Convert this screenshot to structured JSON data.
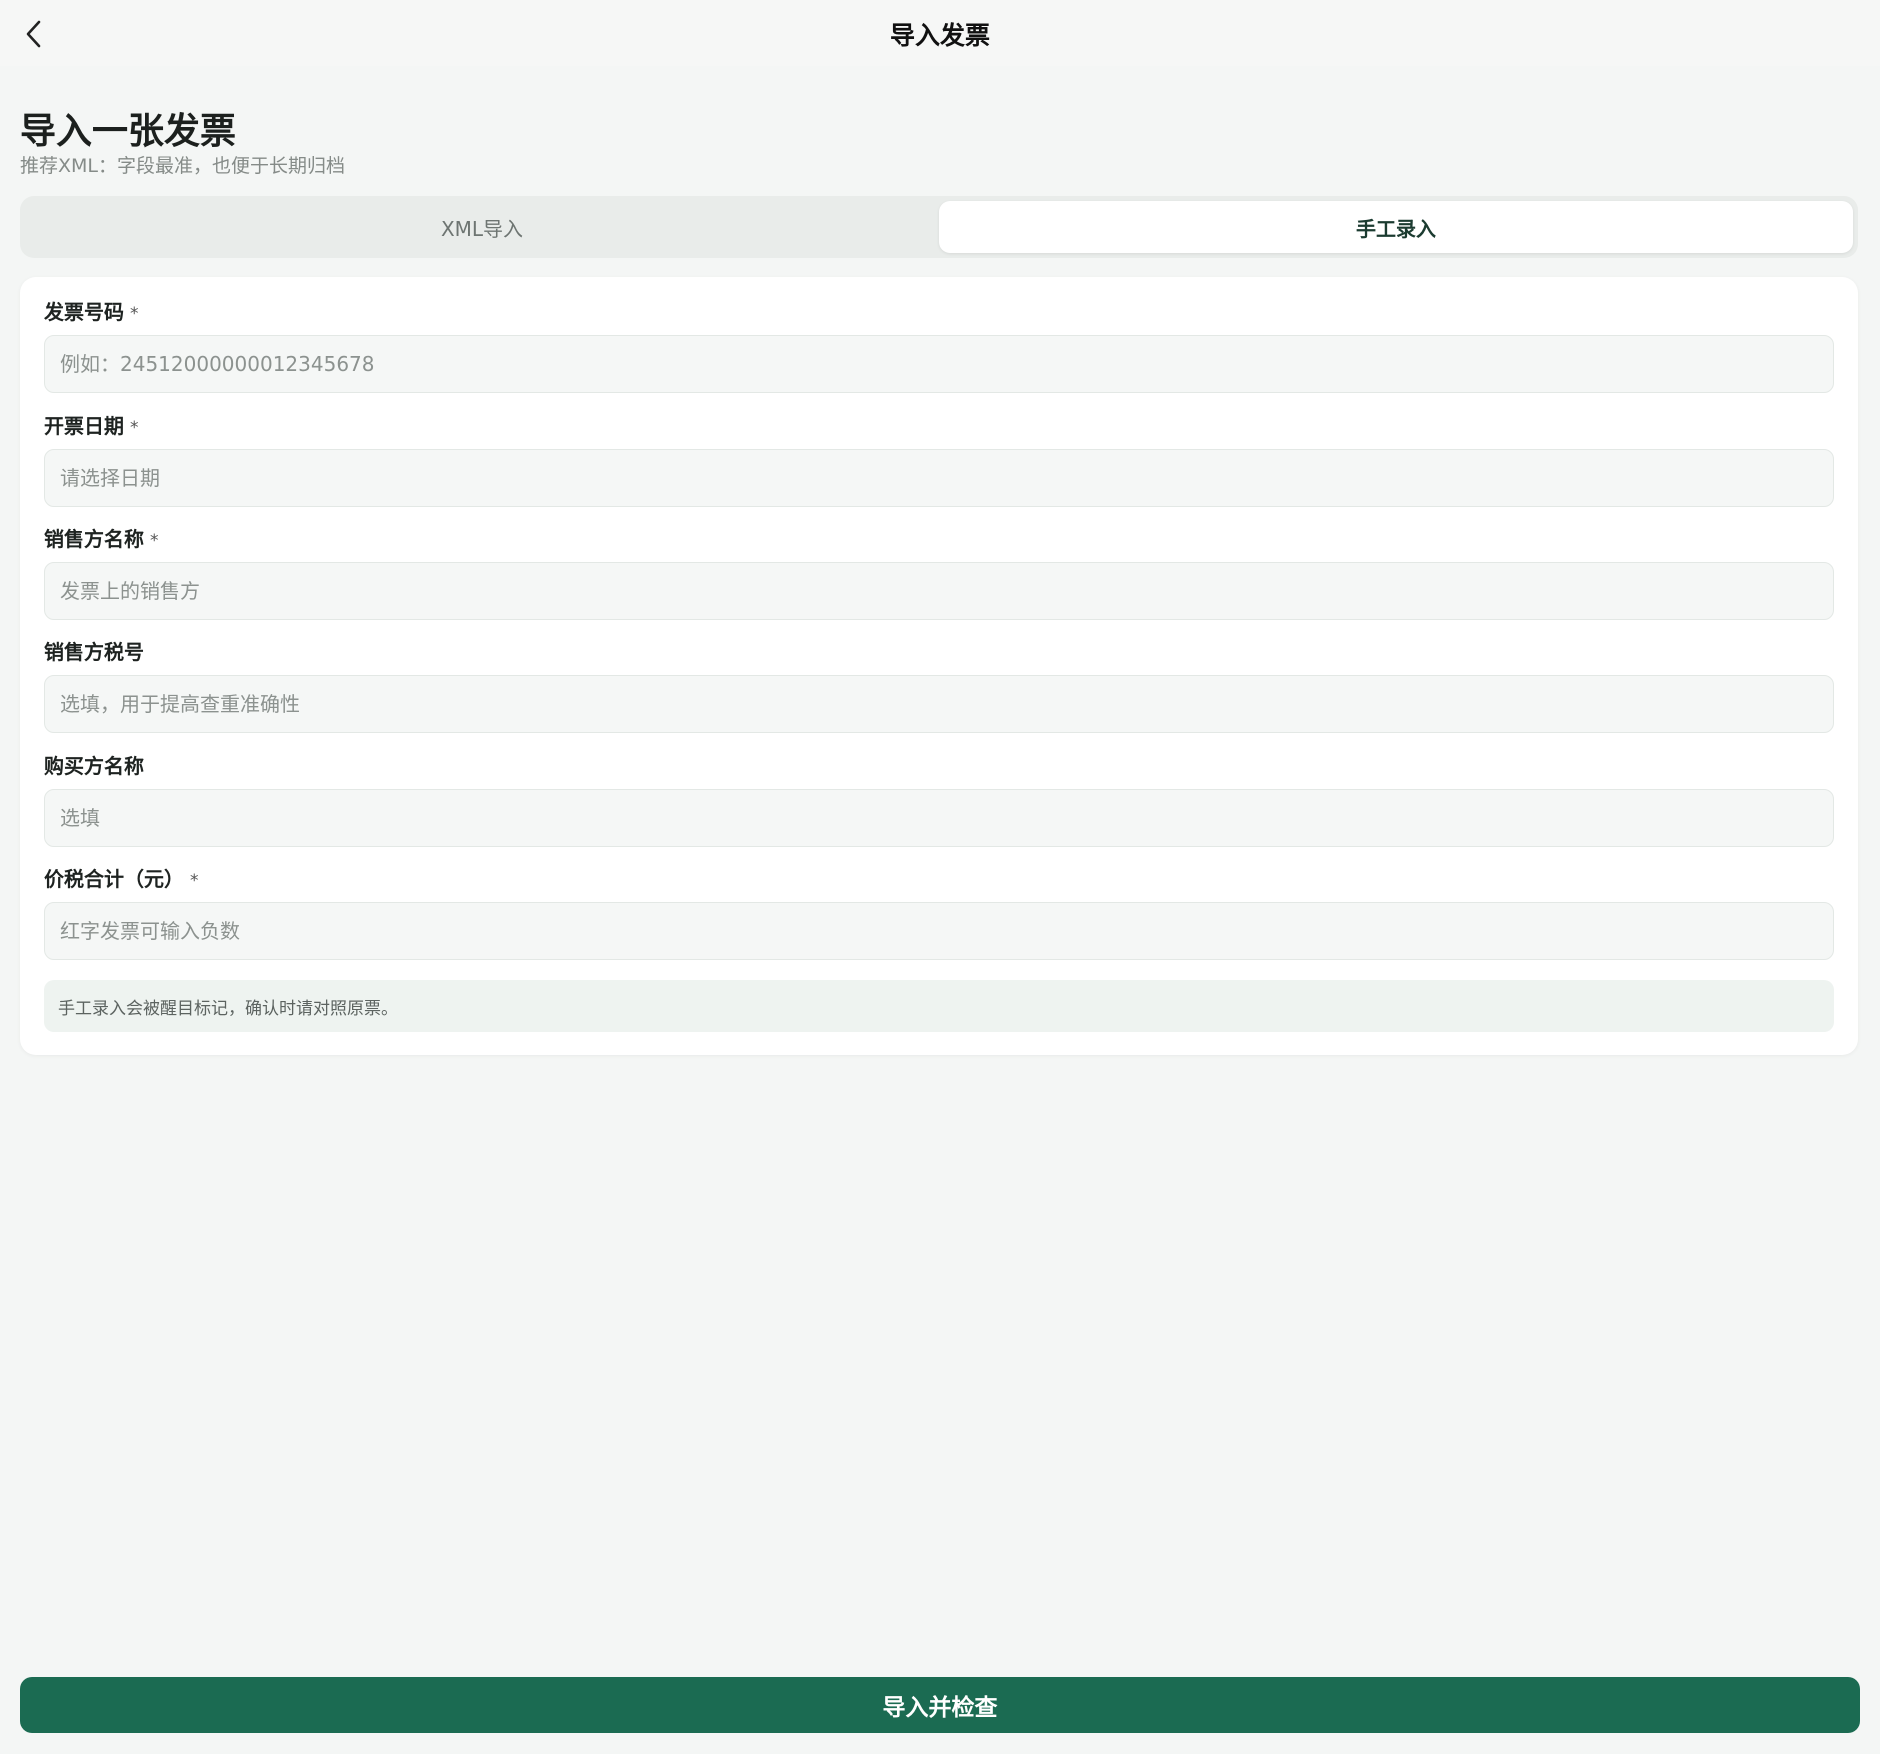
{
  "colors": {
    "accent": "#1b6b52",
    "active_tab_text": "#1b3b30",
    "background": "#f4f6f5"
  },
  "nav": {
    "back_icon": "chevron-left-icon",
    "title": "导入发票"
  },
  "page": {
    "heading": "导入一张发票",
    "subheading": "推荐XML：字段最准，也便于长期归档"
  },
  "tabs": [
    {
      "label": "XML导入",
      "active": false
    },
    {
      "label": "手工录入",
      "active": true
    }
  ],
  "form": {
    "required_mark": "*",
    "fields": [
      {
        "label": "发票号码",
        "required": true,
        "placeholder": "例如：24512000000012345678",
        "value": ""
      },
      {
        "label": "开票日期",
        "required": true,
        "placeholder": "请选择日期",
        "value": ""
      },
      {
        "label": "销售方名称",
        "required": true,
        "placeholder": "发票上的销售方",
        "value": ""
      },
      {
        "label": "销售方税号",
        "required": false,
        "placeholder": "选填，用于提高查重准确性",
        "value": ""
      },
      {
        "label": "购买方名称",
        "required": false,
        "placeholder": "选填",
        "value": ""
      },
      {
        "label": "价税合计（元）",
        "required": true,
        "placeholder": "红字发票可输入负数",
        "value": ""
      }
    ],
    "note": "手工录入会被醒目标记，确认时请对照原票。"
  },
  "submit": {
    "label": "导入并检查"
  }
}
